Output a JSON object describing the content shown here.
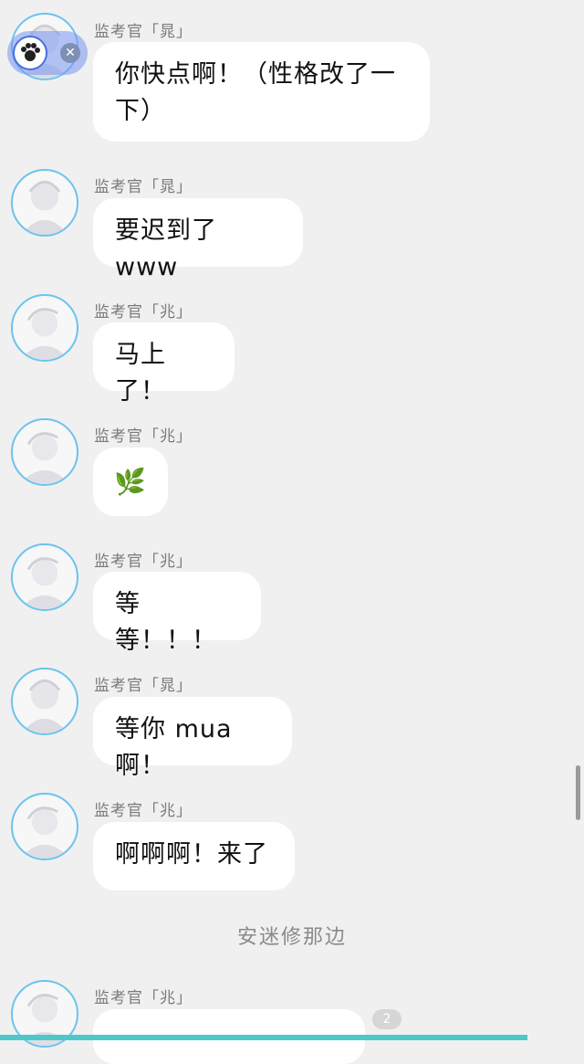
{
  "messages": [
    {
      "sender": "监考官「晁」",
      "text": "你快点啊！（性格改了一\n下）"
    },
    {
      "sender": "监考官「晁」",
      "text": "要迟到了 www"
    },
    {
      "sender": "监考官「兆」",
      "text": "马上了！"
    },
    {
      "sender": "监考官「兆」",
      "emoji": "🌿"
    },
    {
      "sender": "监考官「兆」",
      "text": "等等！！！"
    },
    {
      "sender": "监考官「晁」",
      "text": "等你 mua 啊！"
    },
    {
      "sender": "监考官「兆」",
      "text": "啊啊啊！来了"
    }
  ],
  "divider_text": "安迷修那边",
  "last_message": {
    "sender": "监考官「兆」",
    "badge": "2"
  },
  "float_widget": {
    "close_glyph": "✕"
  },
  "colors": {
    "avatar_ring": "#6cc3ef",
    "bottom_bar": "#4ec7c9",
    "background": "#f0f0f0"
  }
}
